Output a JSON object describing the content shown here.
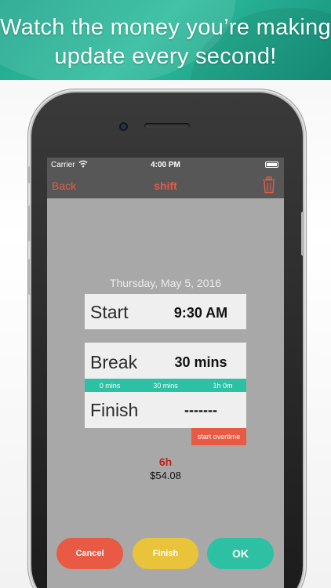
{
  "banner": {
    "line1": "Watch the money you’re making",
    "line2": "update every second!"
  },
  "status_bar": {
    "carrier": "Carrier",
    "time": "4:00 PM",
    "icons": [
      "wifi-icon",
      "battery-icon"
    ]
  },
  "nav": {
    "back_label": "Back",
    "title": "shift",
    "trash_icon": "trash-icon"
  },
  "shift": {
    "date": "Thursday, May 5, 2016",
    "start_label": "Start",
    "start_value": "9:30 AM",
    "break_label": "Break",
    "break_value": "30 mins",
    "break_ticks": [
      "0 mins",
      "30 mins",
      "1h 0m"
    ],
    "finish_label": "Finish",
    "finish_value": "-------",
    "overtime_label": "start overtime"
  },
  "summary": {
    "hours": "6h",
    "earnings": "$54.08"
  },
  "actions": {
    "cancel_label": "Cancel",
    "finish_label": "Finish",
    "ok_label": "OK"
  },
  "colors": {
    "accent_red": "#e85a44",
    "accent_teal": "#2dc0a3",
    "accent_yellow": "#e9c43a",
    "screen_gray": "#a8a8a8",
    "bar_gray": "#575757",
    "hours_red": "#c0211a"
  }
}
